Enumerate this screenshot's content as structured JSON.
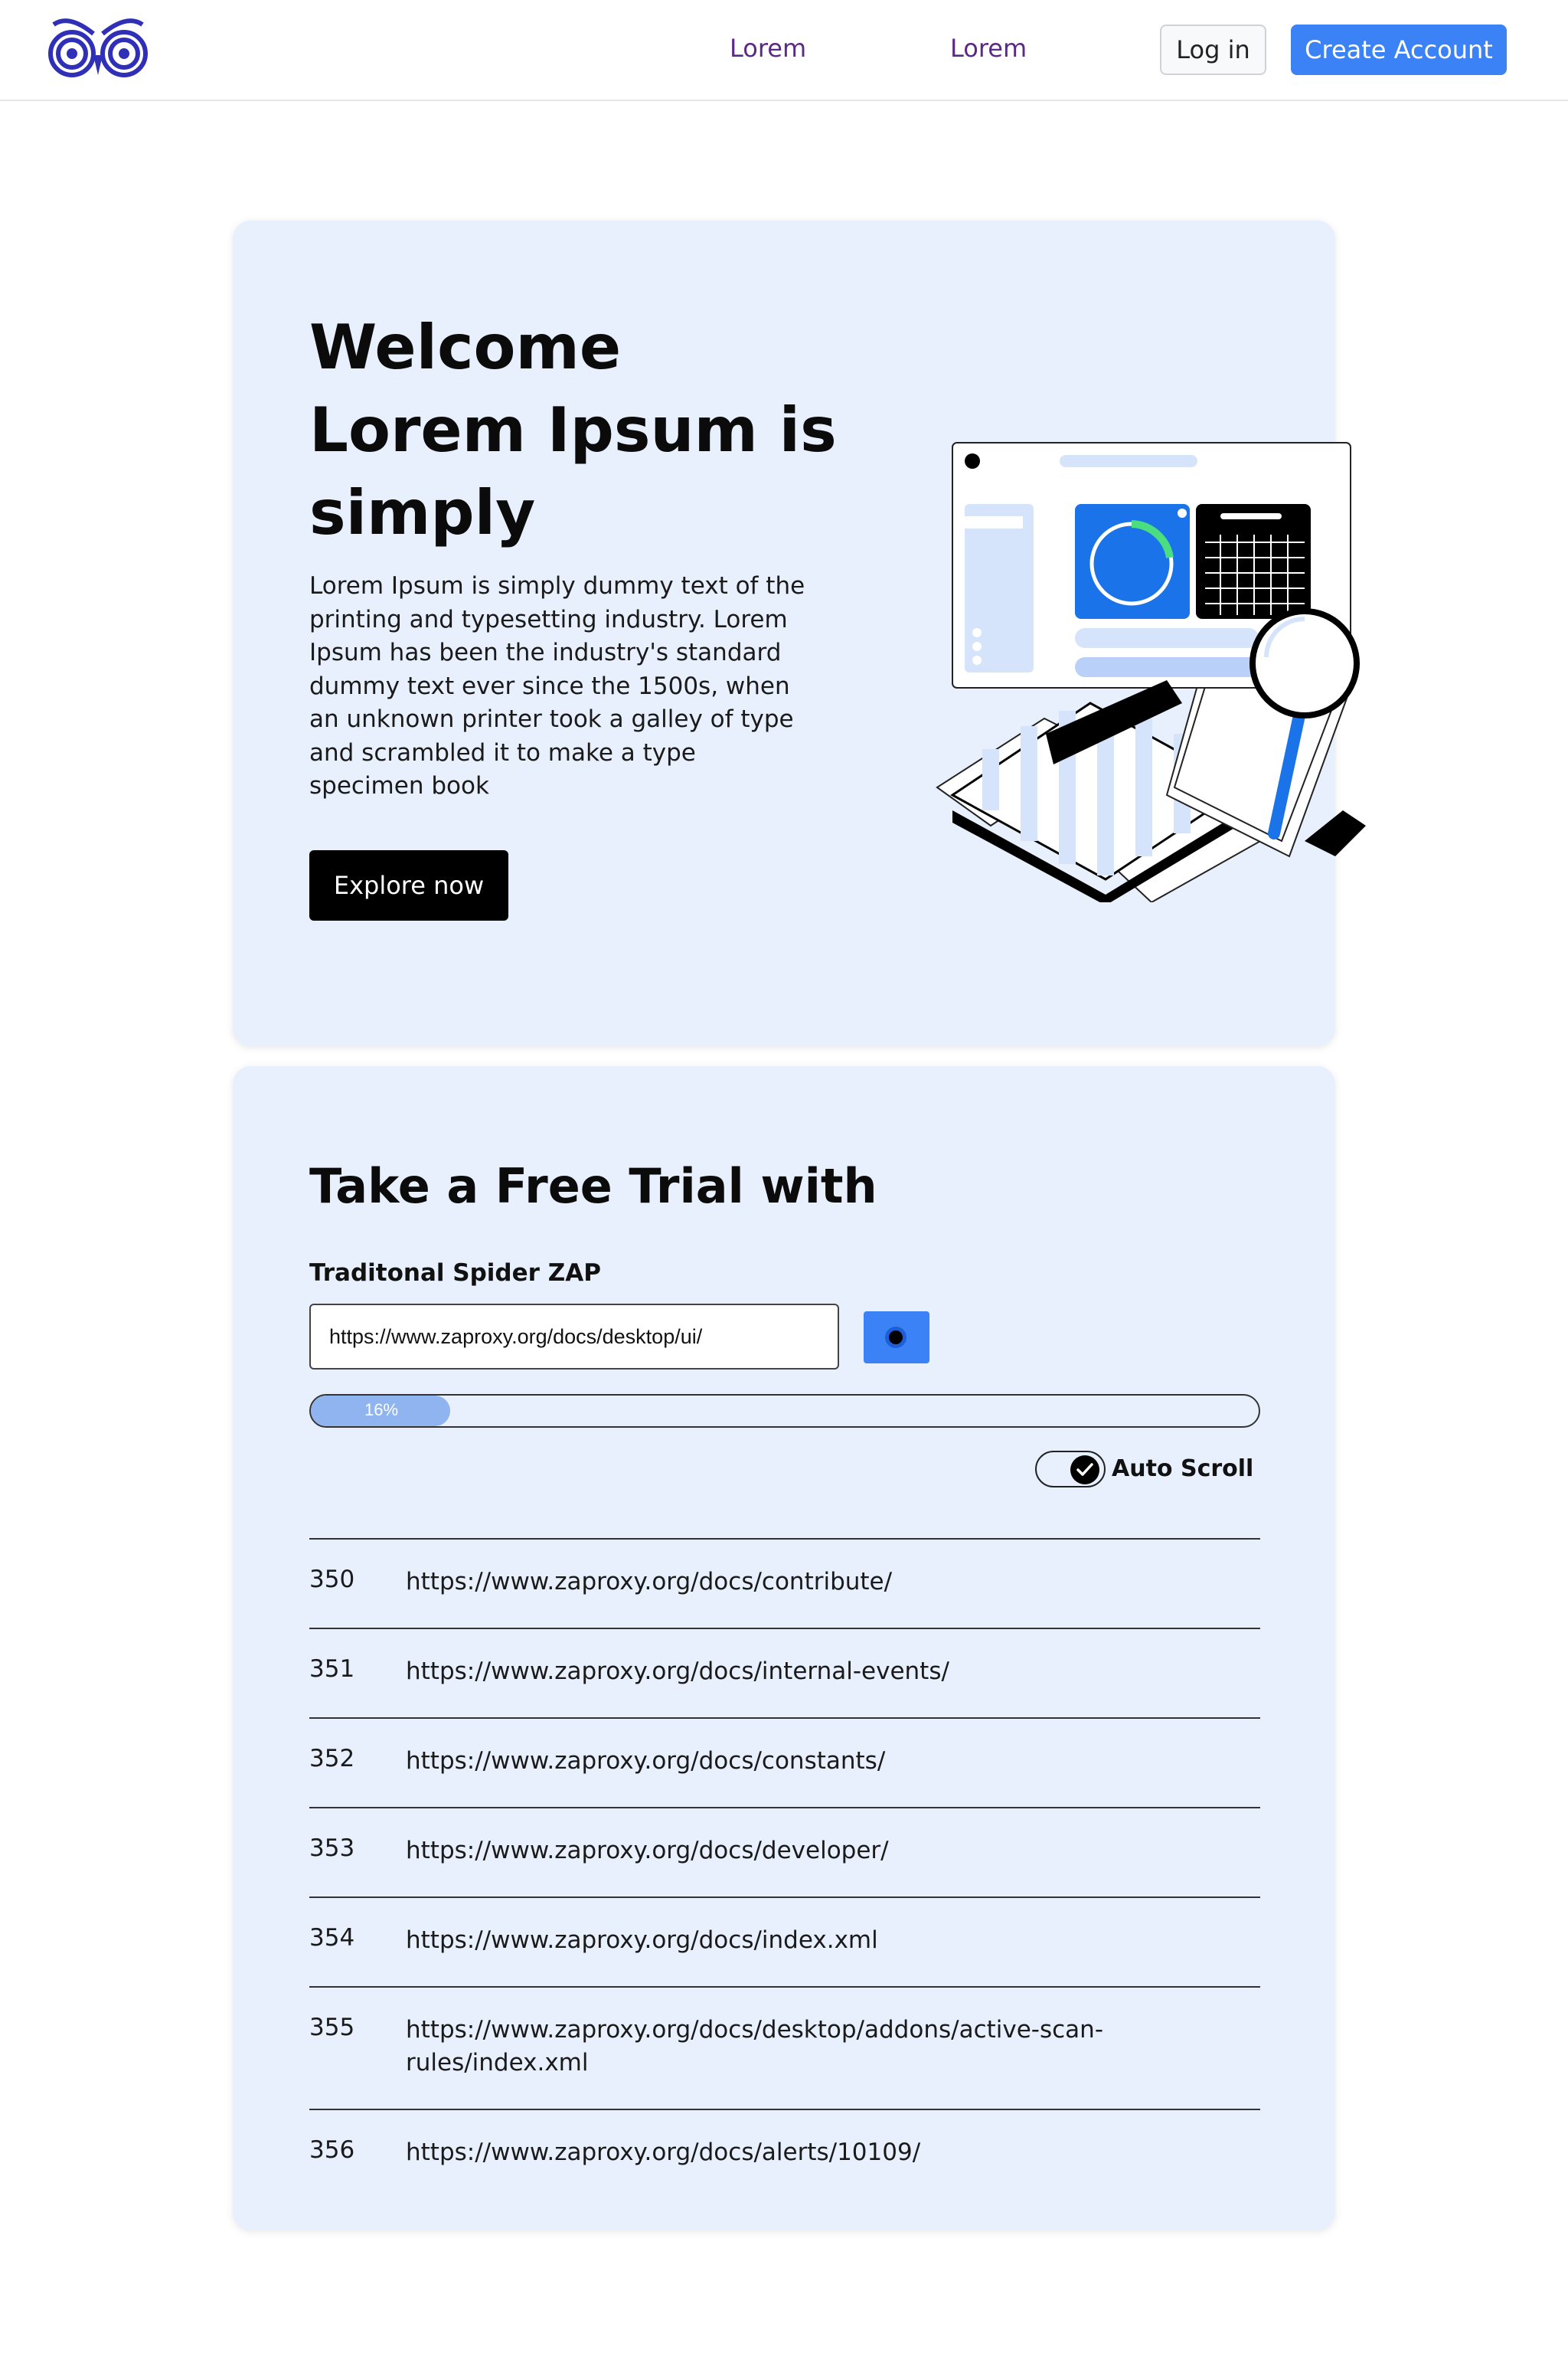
{
  "header": {
    "nav": [
      "Lorem",
      "Lorem"
    ],
    "login_label": "Log in",
    "create_label": "Create Account"
  },
  "hero": {
    "title_lines": [
      "Welcome",
      "Lorem Ipsum is",
      "simply"
    ],
    "description": "Lorem Ipsum is simply dummy text of the printing and typesetting industry. Lorem Ipsum has been the industry's standard dummy text ever since the 1500s, when an unknown printer took a galley of type and scrambled it to make a type specimen book",
    "button_label": "Explore now"
  },
  "trial": {
    "title": "Take a Free Trial with",
    "spider_label": "Traditonal Spider ZAP",
    "url_value": "https://www.zaproxy.org/docs/desktop/ui/",
    "progress_percent": 16,
    "progress_label": "16%",
    "auto_scroll_label": "Auto Scroll",
    "auto_scroll_on": true,
    "results": [
      {
        "id": "350",
        "url": "https://www.zaproxy.org/docs/contribute/"
      },
      {
        "id": "351",
        "url": "https://www.zaproxy.org/docs/internal-events/"
      },
      {
        "id": "352",
        "url": "https://www.zaproxy.org/docs/constants/"
      },
      {
        "id": "353",
        "url": "https://www.zaproxy.org/docs/developer/"
      },
      {
        "id": "354",
        "url": "https://www.zaproxy.org/docs/index.xml"
      },
      {
        "id": "355",
        "url": "https://www.zaproxy.org/docs/desktop/addons/active-scan-rules/index.xml"
      },
      {
        "id": "356",
        "url": "https://www.zaproxy.org/docs/alerts/10109/"
      }
    ]
  },
  "colors": {
    "brand_blue": "#3b82f6",
    "logo_blue": "#2f2fb8",
    "card_bg": "#e8f0fd",
    "nav_link": "#5b2a86"
  },
  "icons": {
    "logo": "owl-eyes-logo",
    "go": "go-button-dot-icon",
    "toggle": "checkmark-icon"
  }
}
